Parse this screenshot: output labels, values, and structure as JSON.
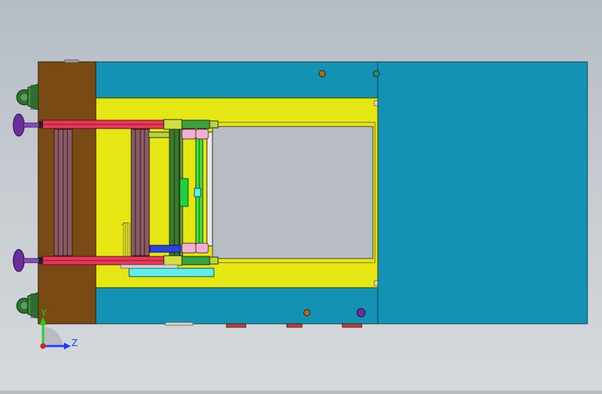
{
  "view": {
    "kind": "cad-orthographic-view",
    "colors": {
      "frame_brown": "#7a4a14",
      "panel_teal": "#1492b4",
      "plate_yellow": "#e6e614",
      "rail_red": "#e8385a",
      "foot_purple": "#6a2e9a",
      "caster_green": "#3a8a3a",
      "window_gray": "#b8bcc4",
      "accent_cyan": "#5ff0e8",
      "accent_blue": "#2b44e0"
    }
  },
  "triad": {
    "y_label": "Y",
    "z_label": "Z",
    "y_color": "#22cc22",
    "z_color": "#1c3cff",
    "origin_color": "#e02020"
  }
}
